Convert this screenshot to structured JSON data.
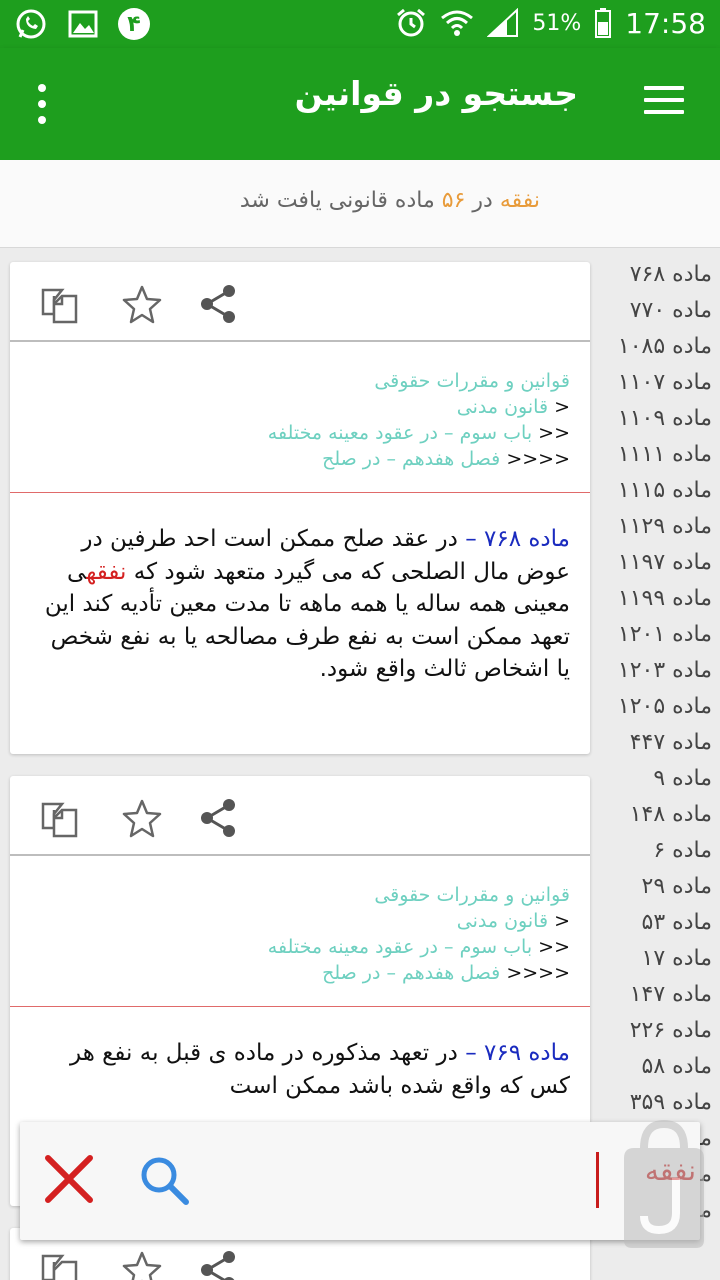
{
  "status_bar": {
    "battery": "51%",
    "time": "17:58",
    "notification_badge": "۴",
    "icons": [
      "whatsapp-icon",
      "gallery-icon",
      "badge-icon",
      "alarm-icon",
      "wifi-icon",
      "signal-icon",
      "battery-icon"
    ]
  },
  "app_bar": {
    "title": "جستجو در قوانین"
  },
  "summary": {
    "term": "نفقه",
    "in_word": "در",
    "count": "۵۶",
    "rest": "ماده قانونی یافت شد"
  },
  "sidebar": {
    "items": [
      "ماده ۷۶۸",
      "ماده ۷۷۰",
      "ماده ۱۰۸۵",
      "ماده ۱۱۰۷",
      "ماده ۱۱۰۹",
      "ماده ۱۱۱۱",
      "ماده ۱۱۱۵",
      "ماده ۱۱۲۹",
      "ماده ۱۱۹۷",
      "ماده ۱۱۹۹",
      "ماده ۱۲۰۱",
      "ماده ۱۲۰۳",
      "ماده ۱۲۰۵",
      "ماده ۴۴۷",
      "ماده ۹",
      "ماده ۱۴۸",
      "ماده ۶",
      "ماده ۲۹",
      "ماده ۵۳",
      "ماده ۱۷",
      "ماده ۱۴۷",
      "ماده ۲۲۶",
      "ماده ۵۸",
      "ماده ۳۵۹",
      "ماده ۲۰",
      "ماده ۸۱",
      "ماده ۸۳"
    ]
  },
  "cards": [
    {
      "path": {
        "l1": "قوانین و مقررات حقوقی",
        "a2": "<",
        "l2": "قانون مدنی",
        "a3": "<<",
        "l3": "باب سوم – در عقود معینه مختلفه",
        "a4": "<<<<",
        "l4": "فصل هفدهم – در صلح"
      },
      "article_num": "ماده ۷۶۸ –",
      "text_before": "در عقد صلح ممکن است احد طرفین در عوض مال الصلحی که می گیرد متعهد شود که",
      "highlight": "نفقه",
      "text_after": "ی معینی همه ساله یا همه ماهه تا مدت معین تأدیه کند این تعهد ممکن است به نفع طرف مصالحه یا به نفع شخص یا اشخاص ثالث واقع شود."
    },
    {
      "path": {
        "l1": "قوانین و مقررات حقوقی",
        "a2": "<",
        "l2": "قانون مدنی",
        "a3": "<<",
        "l3": "باب سوم – در عقود معینه مختلفه",
        "a4": "<<<<",
        "l4": "فصل هفدهم – در صلح"
      },
      "article_num": "ماده ۷۶۹ –",
      "text_before": "در تعهد مذکوره در ماده  ی قبل به نفع هر کس که واقع شده باشد ممکن است",
      "highlight": "",
      "text_after": ""
    }
  ],
  "search": {
    "value": "نفقه"
  },
  "colors": {
    "primary_green": "#1e9e1e",
    "term_orange": "#e89b3a",
    "article_number_blue": "#1a2bbf",
    "highlight_red": "#d42020",
    "path_teal": "#6ed0c0",
    "search_icon_blue": "#3a8be0",
    "clear_icon_red": "#d42020"
  }
}
